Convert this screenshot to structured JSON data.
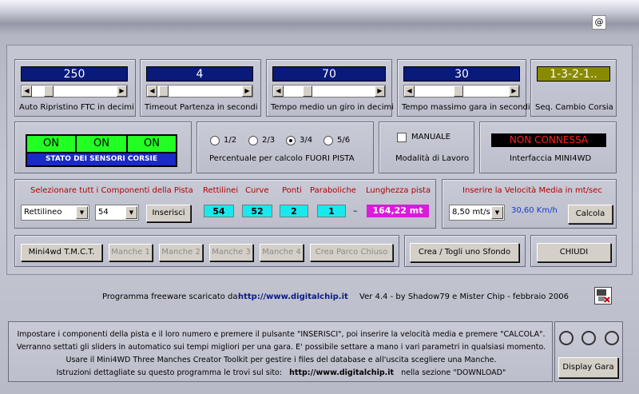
{
  "sliders": [
    {
      "value": "250",
      "label": "Auto Ripristino FTC in decimi",
      "fill": 0.16
    },
    {
      "value": "4",
      "label": "Timeout Partenza in secondi",
      "fill": 0.02
    },
    {
      "value": "70",
      "label": "Tempo medio un giro in decimi",
      "fill": 0.24
    },
    {
      "value": "30",
      "label": "Tempo massimo gara in secondi",
      "fill": 0.46
    },
    {
      "value": "1-3-2-1..",
      "label": "Seq. Cambio Corsia",
      "accent": "#8a8a00"
    }
  ],
  "sensors": {
    "states": [
      "ON",
      "ON",
      "ON"
    ],
    "title": "STATO DEI SENSORI CORSIE",
    "on_color": "#22ff22"
  },
  "fuori_pista": {
    "options": [
      "1/2",
      "2/3",
      "3/4",
      "5/6"
    ],
    "selected": "3/4",
    "label": "Percentuale per calcolo FUORI PISTA"
  },
  "modalita": {
    "checkbox_label": "MANUALE",
    "checked": false,
    "label": "Modalità di Lavoro"
  },
  "interfaccia": {
    "status": "NON CONNESSA",
    "label": "Interfaccia MINI4WD"
  },
  "components": {
    "title": "Selezionare tutt i Componenti della Pista",
    "type_value": "Rettilineo",
    "count_value": "54",
    "insert_button": "Inserisci",
    "headers": [
      "Rettilinei",
      "Curve",
      "Ponti",
      "Paraboliche",
      "Lunghezza pista"
    ],
    "values": [
      "54",
      "52",
      "2",
      "1"
    ],
    "dash": "–",
    "length": "164,22 mt"
  },
  "speed": {
    "title": "Inserire la Velocità Media in mt/sec",
    "value": "8,50 mt/s",
    "kmh": "30,60 Km/h",
    "calc_button": "Calcola"
  },
  "manche_buttons": [
    "Mini4wd T.M.C.T.",
    "Manche 1",
    "Manche 2",
    "Manche 3",
    "Manche 4",
    "Crea Parco Chiuso"
  ],
  "sfondo_button": "Crea / Togli uno Sfondo",
  "close_button": "CHIUDI",
  "footer": {
    "freeware": "Programma freeware scaricato da:",
    "url": "http://www.digitalchip.it",
    "version": "Ver 4.4 - by Shadow79 e Mister Chip - febbraio 2006"
  },
  "instructions": {
    "lines": [
      "Impostare i componenti della pista e il loro numero e premere il pulsante \"INSERISCI\", poi inserire la velocità media e premere \"CALCOLA\".",
      "Verranno settati gli sliders in automatico sui tempi migliori per una gara. E' possibile settare a mano i vari parametri in qualsiasi momento.",
      "Usare il Mini4WD Three Manches Creator Toolkit per gestire i files del database e all'uscita scegliere una Manche."
    ],
    "last_prefix": "Istruzioni dettagliate su questo programma le trovi sul sito:",
    "last_url": "http://www.digitalchip.it",
    "last_suffix": "nella sezione \"DOWNLOAD\""
  },
  "display_button": "Display Gara",
  "top_icon": "@"
}
